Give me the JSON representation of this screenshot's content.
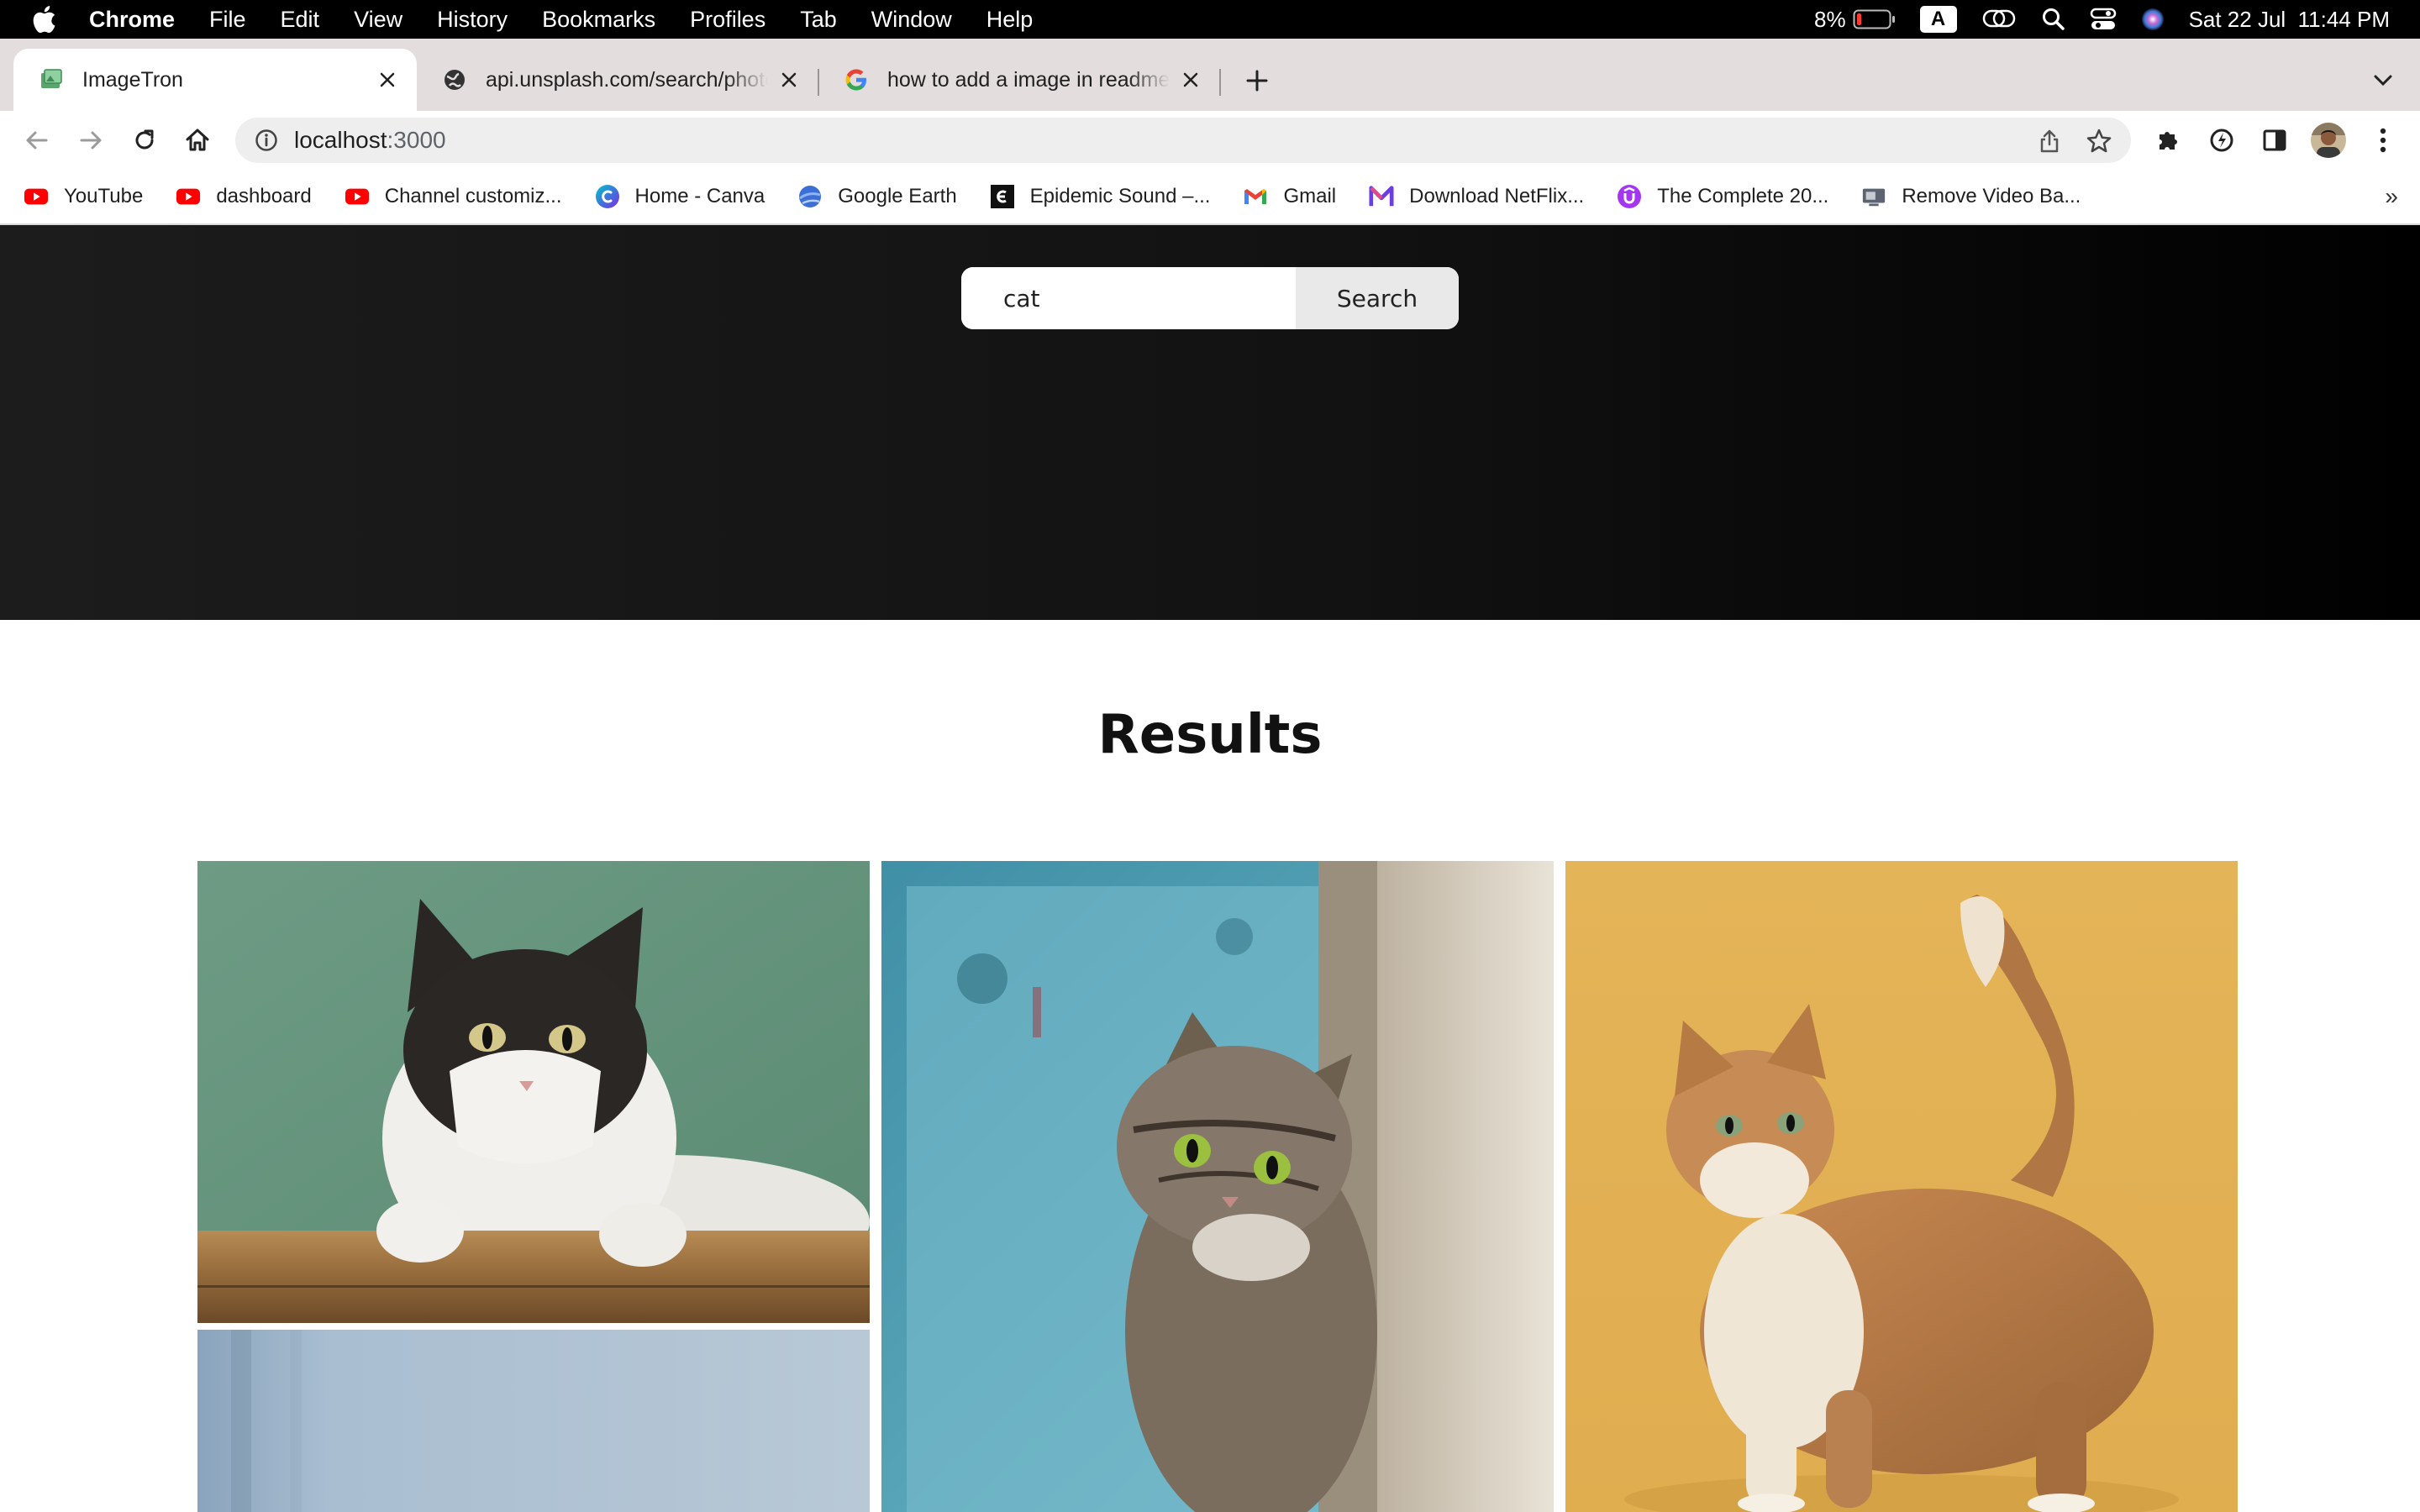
{
  "menubar": {
    "app_name": "Chrome",
    "items": [
      "File",
      "Edit",
      "View",
      "History",
      "Bookmarks",
      "Profiles",
      "Tab",
      "Window",
      "Help"
    ],
    "battery": "8%",
    "input_source": "A",
    "datetime": "Sat 22 Jul  11:44 PM"
  },
  "tabs": [
    {
      "title": "ImageTron",
      "icon": "imagetron-favicon",
      "active": true
    },
    {
      "title": "api.unsplash.com/search/photo",
      "icon": "globe-icon",
      "active": false
    },
    {
      "title": "how to add a image in readme f",
      "icon": "google-icon",
      "active": false
    }
  ],
  "address_bar": {
    "host": "localhost",
    "port": ":3000"
  },
  "bookmarks": [
    {
      "label": "YouTube",
      "icon": "youtube-icon"
    },
    {
      "label": "dashboard",
      "icon": "youtube-icon"
    },
    {
      "label": "Channel customiz...",
      "icon": "youtube-icon"
    },
    {
      "label": "Home - Canva",
      "icon": "canva-icon"
    },
    {
      "label": "Google Earth",
      "icon": "google-earth-icon"
    },
    {
      "label": "Epidemic Sound –...",
      "icon": "epidemic-sound-icon"
    },
    {
      "label": "Gmail",
      "icon": "gmail-icon"
    },
    {
      "label": "Download NetFlix...",
      "icon": "m-logo-icon"
    },
    {
      "label": "The Complete 20...",
      "icon": "udemy-icon"
    },
    {
      "label": "Remove Video Ba...",
      "icon": "video-icon"
    }
  ],
  "bookmarks_more": "»",
  "search": {
    "value": "cat",
    "button_label": "Search"
  },
  "results": {
    "title": "Results",
    "photos": [
      {
        "name": "black-white-cat-green-wall"
      },
      {
        "name": "tabby-cat-peeking"
      },
      {
        "name": "orange-cat-yellow-background"
      },
      {
        "name": "cat-photo-blue-gray"
      }
    ]
  },
  "colors": {
    "menubar": "#000000",
    "tabstrip": "#e3dddd",
    "hero_start": "#1c1c1c",
    "hero_end": "#000000",
    "youtube_red": "#ff0000",
    "battery_low": "#ff3b30"
  }
}
